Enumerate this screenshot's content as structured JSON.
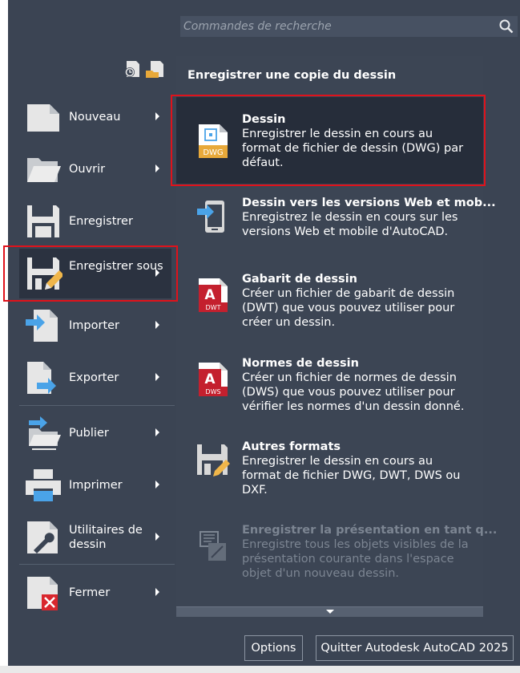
{
  "search": {
    "placeholder": "Commandes de recherche",
    "icon": "search-icon"
  },
  "menu": [
    {
      "label": "Nouveau",
      "icon": "new-document-icon",
      "has_submenu": true
    },
    {
      "label": "Ouvrir",
      "icon": "open-folder-icon",
      "has_submenu": true
    },
    {
      "label": "Enregistrer",
      "icon": "save-icon",
      "has_submenu": false
    },
    {
      "label": "Enregistrer sous",
      "icon": "save-as-icon",
      "has_submenu": true,
      "active": true
    },
    {
      "label": "Importer",
      "icon": "import-icon",
      "has_submenu": true
    },
    {
      "label": "Exporter",
      "icon": "export-icon",
      "has_submenu": true
    },
    {
      "label": "Publier",
      "icon": "publish-icon",
      "has_submenu": true
    },
    {
      "label": "Imprimer",
      "icon": "print-icon",
      "has_submenu": true
    },
    {
      "label": "Utilitaires de dessin",
      "icon": "drawing-utilities-icon",
      "has_submenu": true
    },
    {
      "label": "Fermer",
      "icon": "close-document-icon",
      "has_submenu": true
    }
  ],
  "panel": {
    "header": "Enregistrer une copie du dessin",
    "options": [
      {
        "title": "Dessin",
        "desc": "Enregistrer le dessin en cours au format de fichier de dessin (DWG) par défaut.",
        "icon": "dwg-file-icon",
        "icon_text": "DWG",
        "selected": true
      },
      {
        "title": "Dessin vers les versions Web et mob...",
        "desc": "Enregistrez le dessin en cours sur les versions Web et mobile d'AutoCAD.",
        "icon": "web-mobile-icon"
      },
      {
        "title": "Gabarit de dessin",
        "desc": "Créer un fichier de gabarit de dessin (DWT) que vous pouvez utiliser pour créer un dessin.",
        "icon": "dwt-template-icon",
        "icon_text": "DWT",
        "icon_letter": "A"
      },
      {
        "title": "Normes de dessin",
        "desc": "Créer un fichier de normes de dessin (DWS) que vous pouvez utiliser pour vérifier les normes d'un dessin donné.",
        "icon": "dws-standards-icon",
        "icon_text": "DWS",
        "icon_letter": "A"
      },
      {
        "title": "Autres formats",
        "desc": "Enregistrer le dessin en cours au format de fichier DWG, DWT, DWS ou DXF.",
        "icon": "other-formats-icon"
      },
      {
        "title": "Enregistrer la présentation en tant q...",
        "desc": "Enregistre tous les objets visibles de la présentation courante dans l'espace objet d'un nouveau dessin.",
        "icon": "layout-save-icon",
        "disabled": true
      }
    ]
  },
  "buttons": {
    "options": "Options",
    "quit": "Quitter Autodesk AutoCAD 2025"
  },
  "colors": {
    "background": "#3b4453",
    "selected": "#262d3a",
    "highlight_border": "#e0121b",
    "accent_blue": "#4aa3e8",
    "brand_red": "#c4202e"
  }
}
